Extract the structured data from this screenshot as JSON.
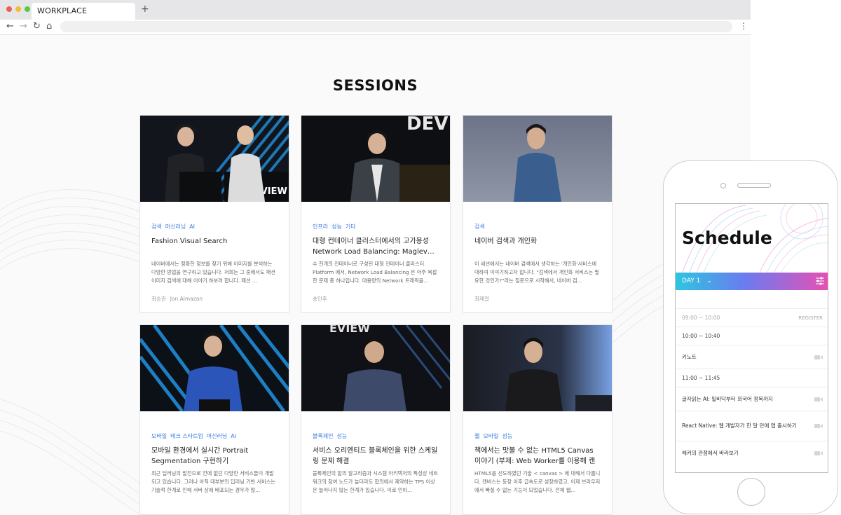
{
  "browser": {
    "tab_title": "WORKPLACE",
    "new_tab": "+",
    "back": "←",
    "forward": "→",
    "reload": "↻",
    "home": "⌂",
    "menu": "⋮"
  },
  "page": {
    "title": "SESSIONS"
  },
  "sessions": [
    {
      "tags": [
        "검색",
        "머신러닝",
        "AI"
      ],
      "title": "Fashion Visual Search",
      "desc": "네이버에서는 정확한 정보를 찾기 위해 이미지를 분석하는 다양한 방법을 연구하고 있습니다. 저희는 그 중에서도 패션 이미지 검색에 대해 이야기 하보려 합니다. 패션 ...",
      "speakers": [
        "최승권",
        "Jon Almazan"
      ]
    },
    {
      "tags": [
        "인프라",
        "성능",
        "기타"
      ],
      "title": "대형 컨테이너 클러스터에서의 고가용성 Network Load Balancing: Maglev…",
      "desc": "수 천개의 컨테이너로 구성된 대형 컨테이너 클러스터 Platform 에서, Network Load Balancing 은 아주 복잡한 문제 중 하나입니다. 대용량의 Network 트래픽을...",
      "speakers": [
        "송인주"
      ]
    },
    {
      "tags": [
        "검색"
      ],
      "title": "네이버 검색과 개인화",
      "desc": "이 세션에서는 네이버 검색에서 생각하는 '개인화'서비스에 대하여 이야기하고자 합니다. \"검색에서 개인화 서비스는 필요한 것인가?\"라는 질문으로 시작해서, 네이버 검...",
      "speakers": [
        "최재걸"
      ]
    },
    {
      "tags": [
        "모바일",
        "테크 스타트업",
        "머신러닝",
        "AI"
      ],
      "title": "모바일 환경에서 실시간 Portrait Segmentation 구현하기",
      "desc": "최근 딥러닝의 발전으로 전에 없던 다양한 서비스들이 개발되고 있습니다. 그러나 아직 대부분의 딥러닝 기반 서비스는 기술적 한계로 인해 서버 상에 배포되는 경우가 많...",
      "speakers": []
    },
    {
      "tags": [
        "블록체인",
        "성능"
      ],
      "title": "서비스 오리엔티드 블록체인을 위한 스케일링 문제 해결",
      "desc": "블록체인의 합의 알고리즘과 시스템 아키텍처의 특성상 네트워크의 참여 노드가 늘더라도 합의에서 제약하는 TPS 이상은 늘어나지 않는 한계가 있습니다. 이로 인하...",
      "speakers": []
    },
    {
      "tags": [
        "웹",
        "모바일",
        "성능"
      ],
      "title": "책에서는 맛볼 수 없는 HTML5 Canvas 이야기 (부제: Web Worker를 이용해 캔버…",
      "desc": "HTML5를 선도하였던 기술 < canvas > 에 대해서 다룹니다. 캔버스는 등장 이후 급속도로 성장하였고, 이제 브라우저에서 빠질 수 없는 기능이 되었습니다. 전체 웹...",
      "speakers": []
    }
  ],
  "phone": {
    "title": "Schedule",
    "day_label": "DAY 1",
    "day_chevron": "⌄",
    "rows": [
      {
        "kind": "time",
        "text": "09:00 ~ 10:00",
        "action": "REGISTER"
      },
      {
        "kind": "time",
        "text": "10:00 ~ 10:40"
      },
      {
        "kind": "session",
        "text": "키노트"
      },
      {
        "kind": "time",
        "text": "11:00 ~ 11:45"
      },
      {
        "kind": "session",
        "text": "글자읽는 AI: 밑바닥부터 외국어 정복까지"
      },
      {
        "kind": "session",
        "text": "React Native: 웹 개발자가 한 달 만에 앱 출시하기"
      },
      {
        "kind": "session",
        "text": "해커의 관점에서 바라보기"
      }
    ]
  },
  "colors": {
    "tag_blue": "#3a7be0",
    "day_gradient_start": "#2cc6e0",
    "day_gradient_end": "#e84fb3"
  }
}
